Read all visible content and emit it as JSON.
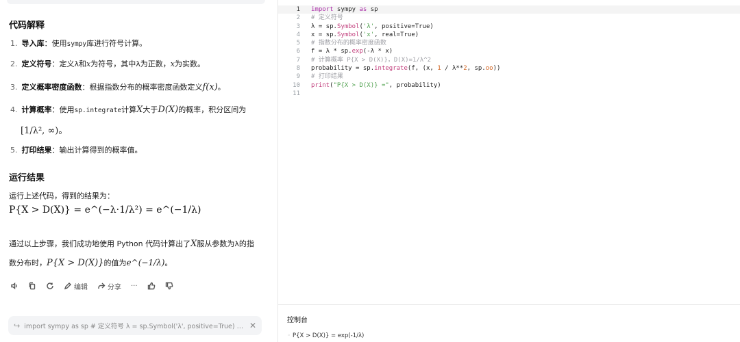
{
  "chat": {
    "code_explain_heading": "代码解释",
    "steps": [
      {
        "num": "1.",
        "title": "导入库",
        "pre": "：使用",
        "code": "sympy",
        "post": "库进行符号计算。"
      },
      {
        "num": "2.",
        "title": "定义符号",
        "pre": "：定义λ和",
        "var": "x",
        "mid": "为符号，其中λ为正数，",
        "var2": "x",
        "post": "为实数。"
      },
      {
        "num": "3.",
        "title": "定义概率密度函数",
        "pre": "：根据指数分布的概率密度函数定义",
        "expr": "f(x)",
        "post": "。"
      },
      {
        "num": "4.",
        "title": "计算概率",
        "pre": "：使用",
        "code": "sp.integrate",
        "mid": "计算",
        "var": "X",
        "mid2": "大于",
        "expr": "D(X)",
        "post": "的概率，积分区间为",
        "cont": "[1/λ², ∞)。"
      },
      {
        "num": "5.",
        "title": "打印结果",
        "pre": "：输出计算得到的概率值。"
      }
    ],
    "result_heading": "运行结果",
    "result_intro": "运行上述代码，得到的结果为：",
    "result_formula": "P{X > D(X)} = e^(−λ·1/λ²) = e^(−1/λ)",
    "summary_line1_pre": "通过以上步骤，我们成功地使用 Python 代码计算出了",
    "summary_var": "X",
    "summary_line1_post": "服从参数为λ的指",
    "summary_line2_pre": "数分布时，",
    "summary_expr": "P{X > D(X)}",
    "summary_line2_mid": "的值为",
    "summary_value": "e^(−1/λ)",
    "summary_line2_post": "。",
    "actions": {
      "edit": "编辑",
      "share": "分享",
      "more": "···"
    },
    "quote_text": "import sympy as sp # 定义符号 λ = sp.Symbol('λ', positive=True) x = sp..."
  },
  "editor": {
    "lines": [
      {
        "n": "1",
        "active": true
      },
      {
        "n": "2"
      },
      {
        "n": "3"
      },
      {
        "n": "4"
      },
      {
        "n": "5"
      },
      {
        "n": "6"
      },
      {
        "n": "7"
      },
      {
        "n": "8"
      },
      {
        "n": "9"
      },
      {
        "n": "10"
      },
      {
        "n": "11"
      }
    ],
    "code": {
      "l1_kw": "import",
      "l1_a": " sympy ",
      "l1_kw2": "as",
      "l1_b": " sp",
      "l2": "# 定义符号",
      "l3_a": "λ = sp.",
      "l3_fn": "Symbol",
      "l3_b": "(",
      "l3_str": "'λ'",
      "l3_c": ", positive=True)",
      "l4_a": "x = sp.",
      "l4_fn": "Symbol",
      "l4_b": "(",
      "l4_str": "'x'",
      "l4_c": ", real=True)",
      "l5": "# 指数分布的概率密度函数",
      "l6_a": "f = λ * sp.",
      "l6_fn": "exp",
      "l6_b": "(-λ * x)",
      "l7": "# 计算概率 P{X > D(X)}，D(X)=1/λ^2",
      "l8_a": "probability = sp.",
      "l8_fn": "integrate",
      "l8_b": "(f, (x, ",
      "l8_num": "1",
      "l8_c": " / λ**",
      "l8_num2": "2",
      "l8_d": ", sp.",
      "l8_oo": "oo",
      "l8_e": "))",
      "l9": "# 打印结果",
      "l10_fn": "print",
      "l10_a": "(",
      "l10_str": "\"P{X > D(X)} =\"",
      "l10_b": ", probability)"
    }
  },
  "console": {
    "title": "控制台",
    "output": "P{X > D(X)} = exp(-1/λ)"
  }
}
